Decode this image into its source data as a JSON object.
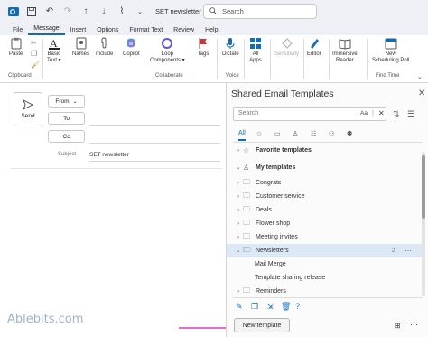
{
  "window": {
    "title": "SET newsletter - Message (HT...",
    "search_placeholder": "Search"
  },
  "menu": {
    "tabs": [
      "File",
      "Message",
      "Insert",
      "Options",
      "Format Text",
      "Review",
      "Help"
    ],
    "active": "Message"
  },
  "ribbon": {
    "paste": "Paste",
    "basic_text": "Basic\nText",
    "names": "Names",
    "include": "Include",
    "copilot": "Copilot",
    "loop": "Loop\nComponents",
    "tags": "Tags",
    "dictate": "Dictate",
    "all_apps": "All\nApps",
    "sensitivity": "Sensitivity",
    "editor": "Editor",
    "immersive": "Immersive\nReader",
    "new_scheduling": "New\nScheduling Poll",
    "groups": {
      "clipboard": "Clipboard",
      "collaborate": "Collaborate",
      "voice": "Voice",
      "find_time": "Find Time"
    }
  },
  "compose": {
    "send": "Send",
    "from": "From",
    "to": "To",
    "cc": "Cc",
    "subject_label": "Subject",
    "subject_value": "SET newsletter"
  },
  "templates_pane": {
    "title": "Shared Email Templates",
    "search_placeholder": "Search",
    "search_case": "Aa",
    "tab_all": "All",
    "items": [
      {
        "label": "Favorite templates",
        "type": "root-favorite",
        "expanded": false
      },
      {
        "label": "My templates",
        "type": "root",
        "expanded": true
      },
      {
        "label": "Congrats",
        "type": "folder"
      },
      {
        "label": "Customer service",
        "type": "folder"
      },
      {
        "label": "Deals",
        "type": "folder"
      },
      {
        "label": "Flower shop",
        "type": "folder"
      },
      {
        "label": "Meeting invites",
        "type": "folder"
      },
      {
        "label": "Newsletters",
        "type": "folder-open",
        "selected": true,
        "count": "2"
      },
      {
        "label": "Mail Merge",
        "type": "template"
      },
      {
        "label": "Template sharing release",
        "type": "template"
      },
      {
        "label": "Reminders",
        "type": "folder"
      }
    ],
    "new_template": "New template"
  },
  "logo": "Ablebits.com",
  "colors": {
    "accent": "#0f6cbd",
    "selected_row": "#dbe8f5",
    "arrow": "#e76ec8"
  }
}
